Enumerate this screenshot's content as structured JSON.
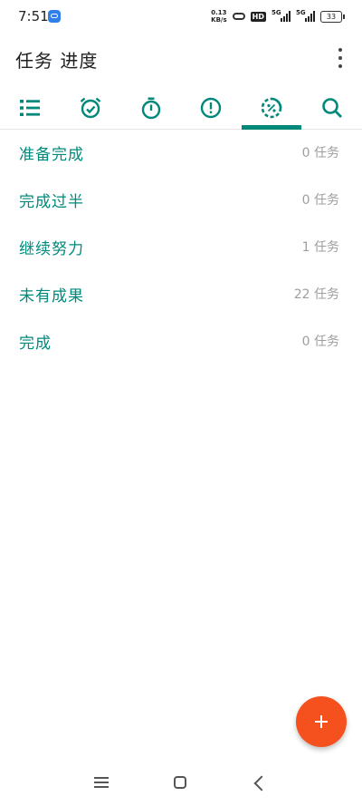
{
  "status_bar": {
    "time": "7:51",
    "net_speed_value": "0.13",
    "net_speed_unit": "KB/s",
    "hd_label": "HD",
    "sim1_label": "5G",
    "sim2_label": "5G",
    "battery": "33"
  },
  "app_bar": {
    "title": "任务 进度"
  },
  "tabs": [
    {
      "icon": "list-icon"
    },
    {
      "icon": "alarm-check-icon"
    },
    {
      "icon": "stopwatch-icon"
    },
    {
      "icon": "alert-circle-icon"
    },
    {
      "icon": "progress-percent-icon",
      "active": true
    },
    {
      "icon": "search-icon"
    }
  ],
  "progress_list": [
    {
      "label": "准备完成",
      "count": "0 任务"
    },
    {
      "label": "完成过半",
      "count": "0 任务"
    },
    {
      "label": "继续努力",
      "count": "1 任务"
    },
    {
      "label": "未有成果",
      "count": "22 任务"
    },
    {
      "label": "完成",
      "count": "0 任务"
    }
  ],
  "colors": {
    "accent": "#00897b",
    "fab": "#f4511e",
    "count_text": "#9e9e9e"
  },
  "fab": {
    "icon": "plus-icon"
  },
  "nav_bar": {
    "icons": [
      "menu-icon",
      "home-icon",
      "back-icon"
    ]
  }
}
